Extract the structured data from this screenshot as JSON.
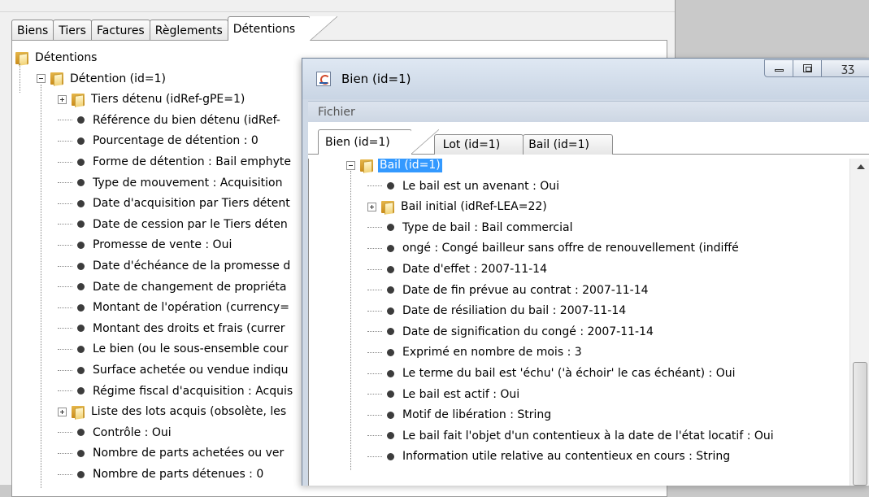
{
  "background_window": {
    "tabs": [
      "Biens",
      "Tiers",
      "Factures",
      "Règlements",
      "Détentions"
    ],
    "active_tab": "Détentions",
    "tree": [
      {
        "label": "Détentions",
        "kind": "folder",
        "level": 0
      },
      {
        "label": "Détention (id=1)",
        "kind": "folder",
        "level": 1,
        "expander": "minus"
      },
      {
        "label": "Tiers détenu (idRef-gPE=1)",
        "kind": "folder",
        "level": 2,
        "expander": "plus"
      },
      {
        "label": "Référence du bien détenu (idRef-",
        "kind": "leaf",
        "level": 2
      },
      {
        "label": "Pourcentage de détention : 0",
        "kind": "leaf",
        "level": 2
      },
      {
        "label": "Forme de détention : Bail emphyte",
        "kind": "leaf",
        "level": 2
      },
      {
        "label": "Type de mouvement : Acquisition",
        "kind": "leaf",
        "level": 2
      },
      {
        "label": "Date d'acquisition par Tiers détent",
        "kind": "leaf",
        "level": 2
      },
      {
        "label": "Date de cession par le Tiers déten",
        "kind": "leaf",
        "level": 2
      },
      {
        "label": "Promesse de vente : Oui",
        "kind": "leaf",
        "level": 2
      },
      {
        "label": "Date d'échéance de la promesse d",
        "kind": "leaf",
        "level": 2
      },
      {
        "label": "Date de changement de propriéta",
        "kind": "leaf",
        "level": 2
      },
      {
        "label": "Montant de l'opération (currency=",
        "kind": "leaf",
        "level": 2
      },
      {
        "label": "Montant des droits et frais (currer",
        "kind": "leaf",
        "level": 2
      },
      {
        "label": "Le bien (ou le sous-ensemble cour",
        "kind": "leaf",
        "level": 2
      },
      {
        "label": "Surface achetée ou vendue indiqu",
        "kind": "leaf",
        "level": 2
      },
      {
        "label": "Régime fiscal d'acquisition : Acquis",
        "kind": "leaf",
        "level": 2
      },
      {
        "label": "Liste des lots acquis (obsolète, les",
        "kind": "folder",
        "level": 2,
        "expander": "plus"
      },
      {
        "label": "Contrôle : Oui",
        "kind": "leaf",
        "level": 2
      },
      {
        "label": "Nombre de parts achetées ou ver",
        "kind": "leaf",
        "level": 2
      },
      {
        "label": "Nombre de parts détenues : 0",
        "kind": "leaf",
        "level": 2
      }
    ]
  },
  "dialog": {
    "title": "Bien (id=1)",
    "menu": [
      "Fichier"
    ],
    "tabs": [
      "Bien (id=1)",
      "Lot (id=1)",
      "Bail (id=1)"
    ],
    "active_tab": "Bien (id=1)",
    "tree": [
      {
        "label": "Bail (id=1)",
        "kind": "folder",
        "level": 0,
        "expander": "minus",
        "selected": true
      },
      {
        "label": "Le bail est un avenant : Oui",
        "kind": "leaf",
        "level": 1
      },
      {
        "label": "Bail initial (idRef-LEA=22)",
        "kind": "folder",
        "level": 1,
        "expander": "plus"
      },
      {
        "label": "Type de bail : Bail commercial",
        "kind": "leaf",
        "level": 1
      },
      {
        "label": "ongé : Congé bailleur sans offre de renouvellement (indiffé",
        "kind": "leaf",
        "level": 1
      },
      {
        "label": "Date d'effet : 2007-11-14",
        "kind": "leaf",
        "level": 1
      },
      {
        "label": "Date de fin prévue au contrat : 2007-11-14",
        "kind": "leaf",
        "level": 1
      },
      {
        "label": "Date de résiliation du bail : 2007-11-14",
        "kind": "leaf",
        "level": 1
      },
      {
        "label": "Date de signification du congé : 2007-11-14",
        "kind": "leaf",
        "level": 1
      },
      {
        "label": "Exprimé en nombre de mois : 3",
        "kind": "leaf",
        "level": 1
      },
      {
        "label": "Le terme du bail est 'échu' ('à échoir' le cas échéant) : Oui",
        "kind": "leaf",
        "level": 1
      },
      {
        "label": "Le bail est actif : Oui",
        "kind": "leaf",
        "level": 1
      },
      {
        "label": "Motif de libération : String",
        "kind": "leaf",
        "level": 1
      },
      {
        "label": "Le bail fait l'objet d'un contentieux à la date de l'état locatif : Oui",
        "kind": "leaf",
        "level": 1
      },
      {
        "label": "Information utile relative au contentieux en cours : String",
        "kind": "leaf",
        "level": 1
      }
    ],
    "window_buttons": {
      "close_glyph": "ʒʒ"
    }
  }
}
